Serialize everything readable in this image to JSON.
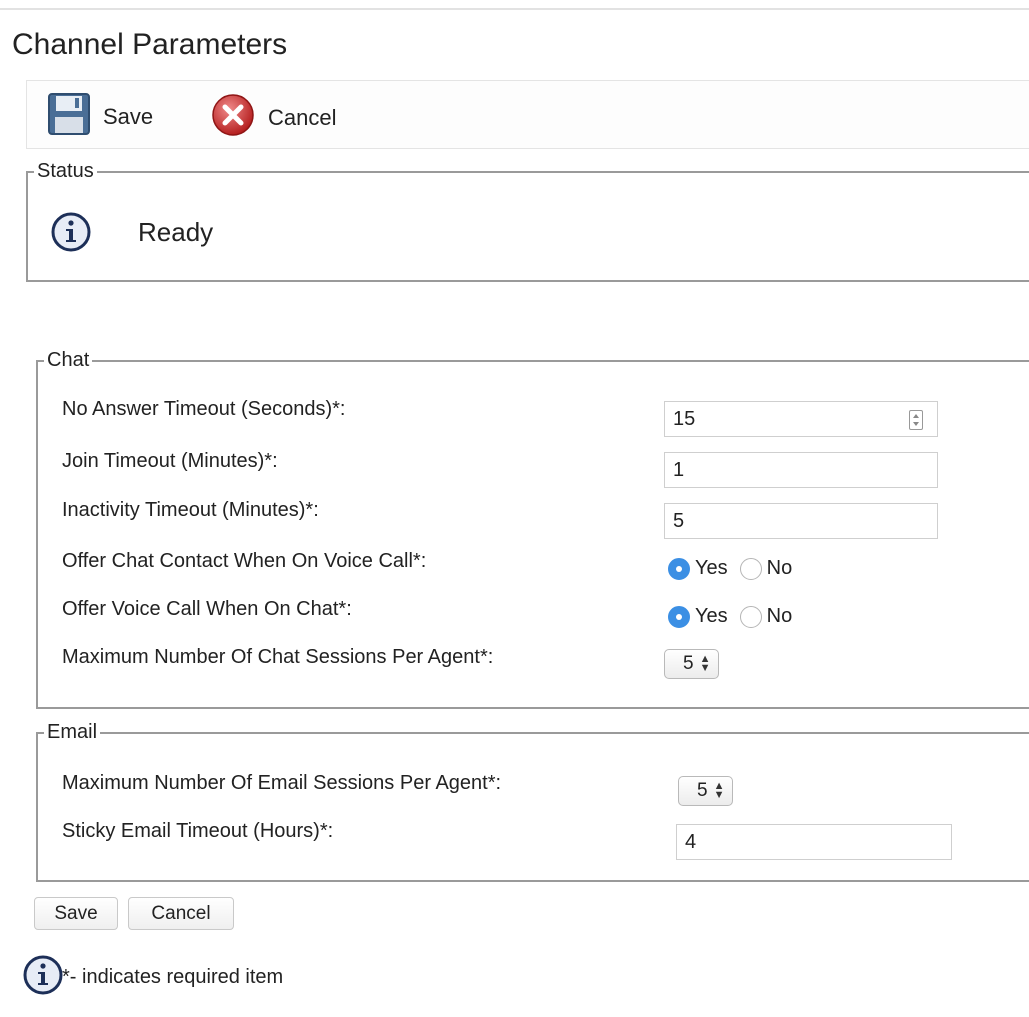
{
  "page": {
    "title": "Channel Parameters"
  },
  "toolbar": {
    "save_label": "Save",
    "cancel_label": "Cancel"
  },
  "status": {
    "legend": "Status",
    "text": "Ready"
  },
  "chat": {
    "legend": "Chat",
    "no_answer": {
      "label": "No Answer Timeout (Seconds)*:",
      "value": "15"
    },
    "join": {
      "label": "Join Timeout (Minutes)*:",
      "value": "1"
    },
    "inactivity": {
      "label": "Inactivity Timeout (Minutes)*:",
      "value": "5"
    },
    "offer_chat": {
      "label": "Offer Chat Contact When On Voice Call*:",
      "yes": "Yes",
      "no": "No",
      "selected": "Yes"
    },
    "offer_voice": {
      "label": "Offer Voice Call When On Chat*:",
      "yes": "Yes",
      "no": "No",
      "selected": "Yes"
    },
    "max_sessions": {
      "label": "Maximum Number Of Chat Sessions Per Agent*:",
      "value": "5"
    }
  },
  "email": {
    "legend": "Email",
    "max_sessions": {
      "label": "Maximum Number Of Email Sessions Per Agent*:",
      "value": "5"
    },
    "sticky": {
      "label": "Sticky Email Timeout (Hours)*:",
      "value": "4"
    }
  },
  "footer": {
    "save_label": "Save",
    "cancel_label": "Cancel",
    "note": "*- indicates required item"
  },
  "icons": {
    "save": "floppy-disk-icon",
    "cancel": "red-x-circle-icon",
    "info": "info-icon"
  }
}
